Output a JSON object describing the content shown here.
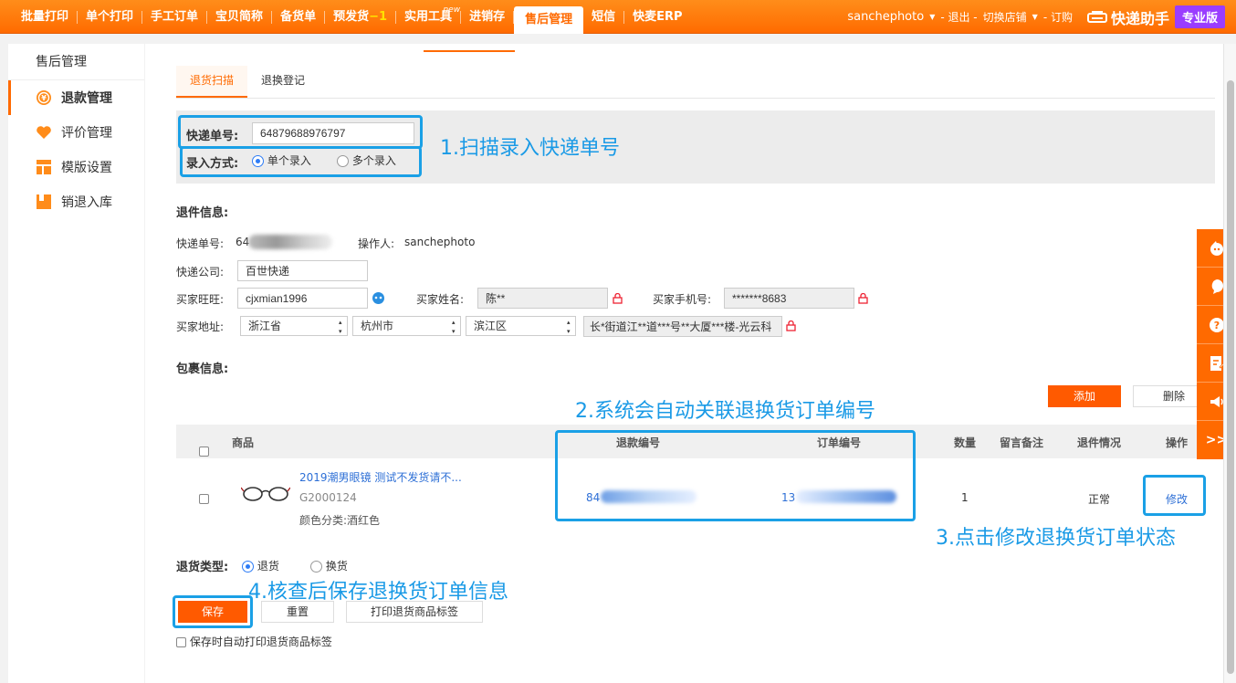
{
  "topbar": {
    "nav": [
      {
        "label": "批量打印"
      },
      {
        "label": "单个打印"
      },
      {
        "label": "手工订单"
      },
      {
        "label": "宝贝简称"
      },
      {
        "label": "备货单"
      },
      {
        "label": "预发货",
        "badge": "−1"
      },
      {
        "label": "实用工具",
        "tag": "new"
      },
      {
        "label": "进销存"
      },
      {
        "label": "售后管理",
        "active": true
      },
      {
        "label": "短信"
      },
      {
        "label": "快麦ERP"
      }
    ],
    "user": "sanchephoto",
    "logout": "- 退出 -",
    "switch_store": "切换店铺",
    "order": "- 订购",
    "brand": "快递助手",
    "edition": "专业版"
  },
  "sidebar": {
    "title": "售后管理",
    "items": [
      {
        "label": "退款管理",
        "icon": "refund-icon",
        "active": true
      },
      {
        "label": "评价管理",
        "icon": "heart-icon"
      },
      {
        "label": "模版设置",
        "icon": "template-icon"
      },
      {
        "label": "销退入库",
        "icon": "inbound-icon"
      }
    ]
  },
  "tabs": [
    "退货扫描",
    "退换登记"
  ],
  "search": {
    "tracking_label": "快递单号:",
    "tracking_value": "64879688976797",
    "mode_label": "录入方式:",
    "mode_single": "单个录入",
    "mode_multi": "多个录入"
  },
  "return_info": {
    "title": "退件信息:",
    "tracking_label": "快递单号:",
    "tracking_value": "64",
    "operator_label": "操作人:",
    "operator_value": "sanchephoto",
    "courier_label": "快递公司:",
    "courier_value": "百世快递",
    "wangwang_label": "买家旺旺:",
    "wangwang_value": "cjxmian1996",
    "name_label": "买家姓名:",
    "name_value": "陈**",
    "phone_label": "买家手机号:",
    "phone_value": "*******8683",
    "address_label": "买家地址:",
    "province": "浙江省",
    "city": "杭州市",
    "district": "滨江区",
    "street": "长*街道江**道***号**大厦***楼-光云科"
  },
  "package": {
    "title": "包裹信息:",
    "add_label": "添加",
    "delete_label": "删除",
    "columns": [
      "商品",
      "退款编号",
      "订单编号",
      "数量",
      "留言备注",
      "退件情况",
      "操作"
    ],
    "row": {
      "name": "2019潮男眼镜 测试不发货请不...",
      "sku": "G2000124",
      "variant": "颜色分类:酒红色",
      "refund_no": "84",
      "order_no": "13",
      "qty": "1",
      "remark": "",
      "status": "正常",
      "action": "修改"
    }
  },
  "return_type": {
    "label": "退货类型:",
    "option_return": "退货",
    "option_exchange": "换货"
  },
  "actions": {
    "save": "保存",
    "reset": "重置",
    "print_label": "打印退货商品标签",
    "auto_print": "保存时自动打印退货商品标签"
  },
  "notes": {
    "n1": "1.扫描录入快递单号",
    "n2": "2.系统会自动关联退换货订单编号",
    "n3": "3.点击修改退换货订单状态",
    "n4": "4.核查后保存退换货订单信息"
  },
  "right_bar": {
    "items": [
      "mascot-icon",
      "chat-icon",
      "help-icon",
      "feedback-icon",
      "announcement-icon"
    ],
    "expand": ">>"
  },
  "colors": {
    "accent": "#ff6a00",
    "highlight": "#1aa0e6",
    "edition": "#9a3dff"
  }
}
